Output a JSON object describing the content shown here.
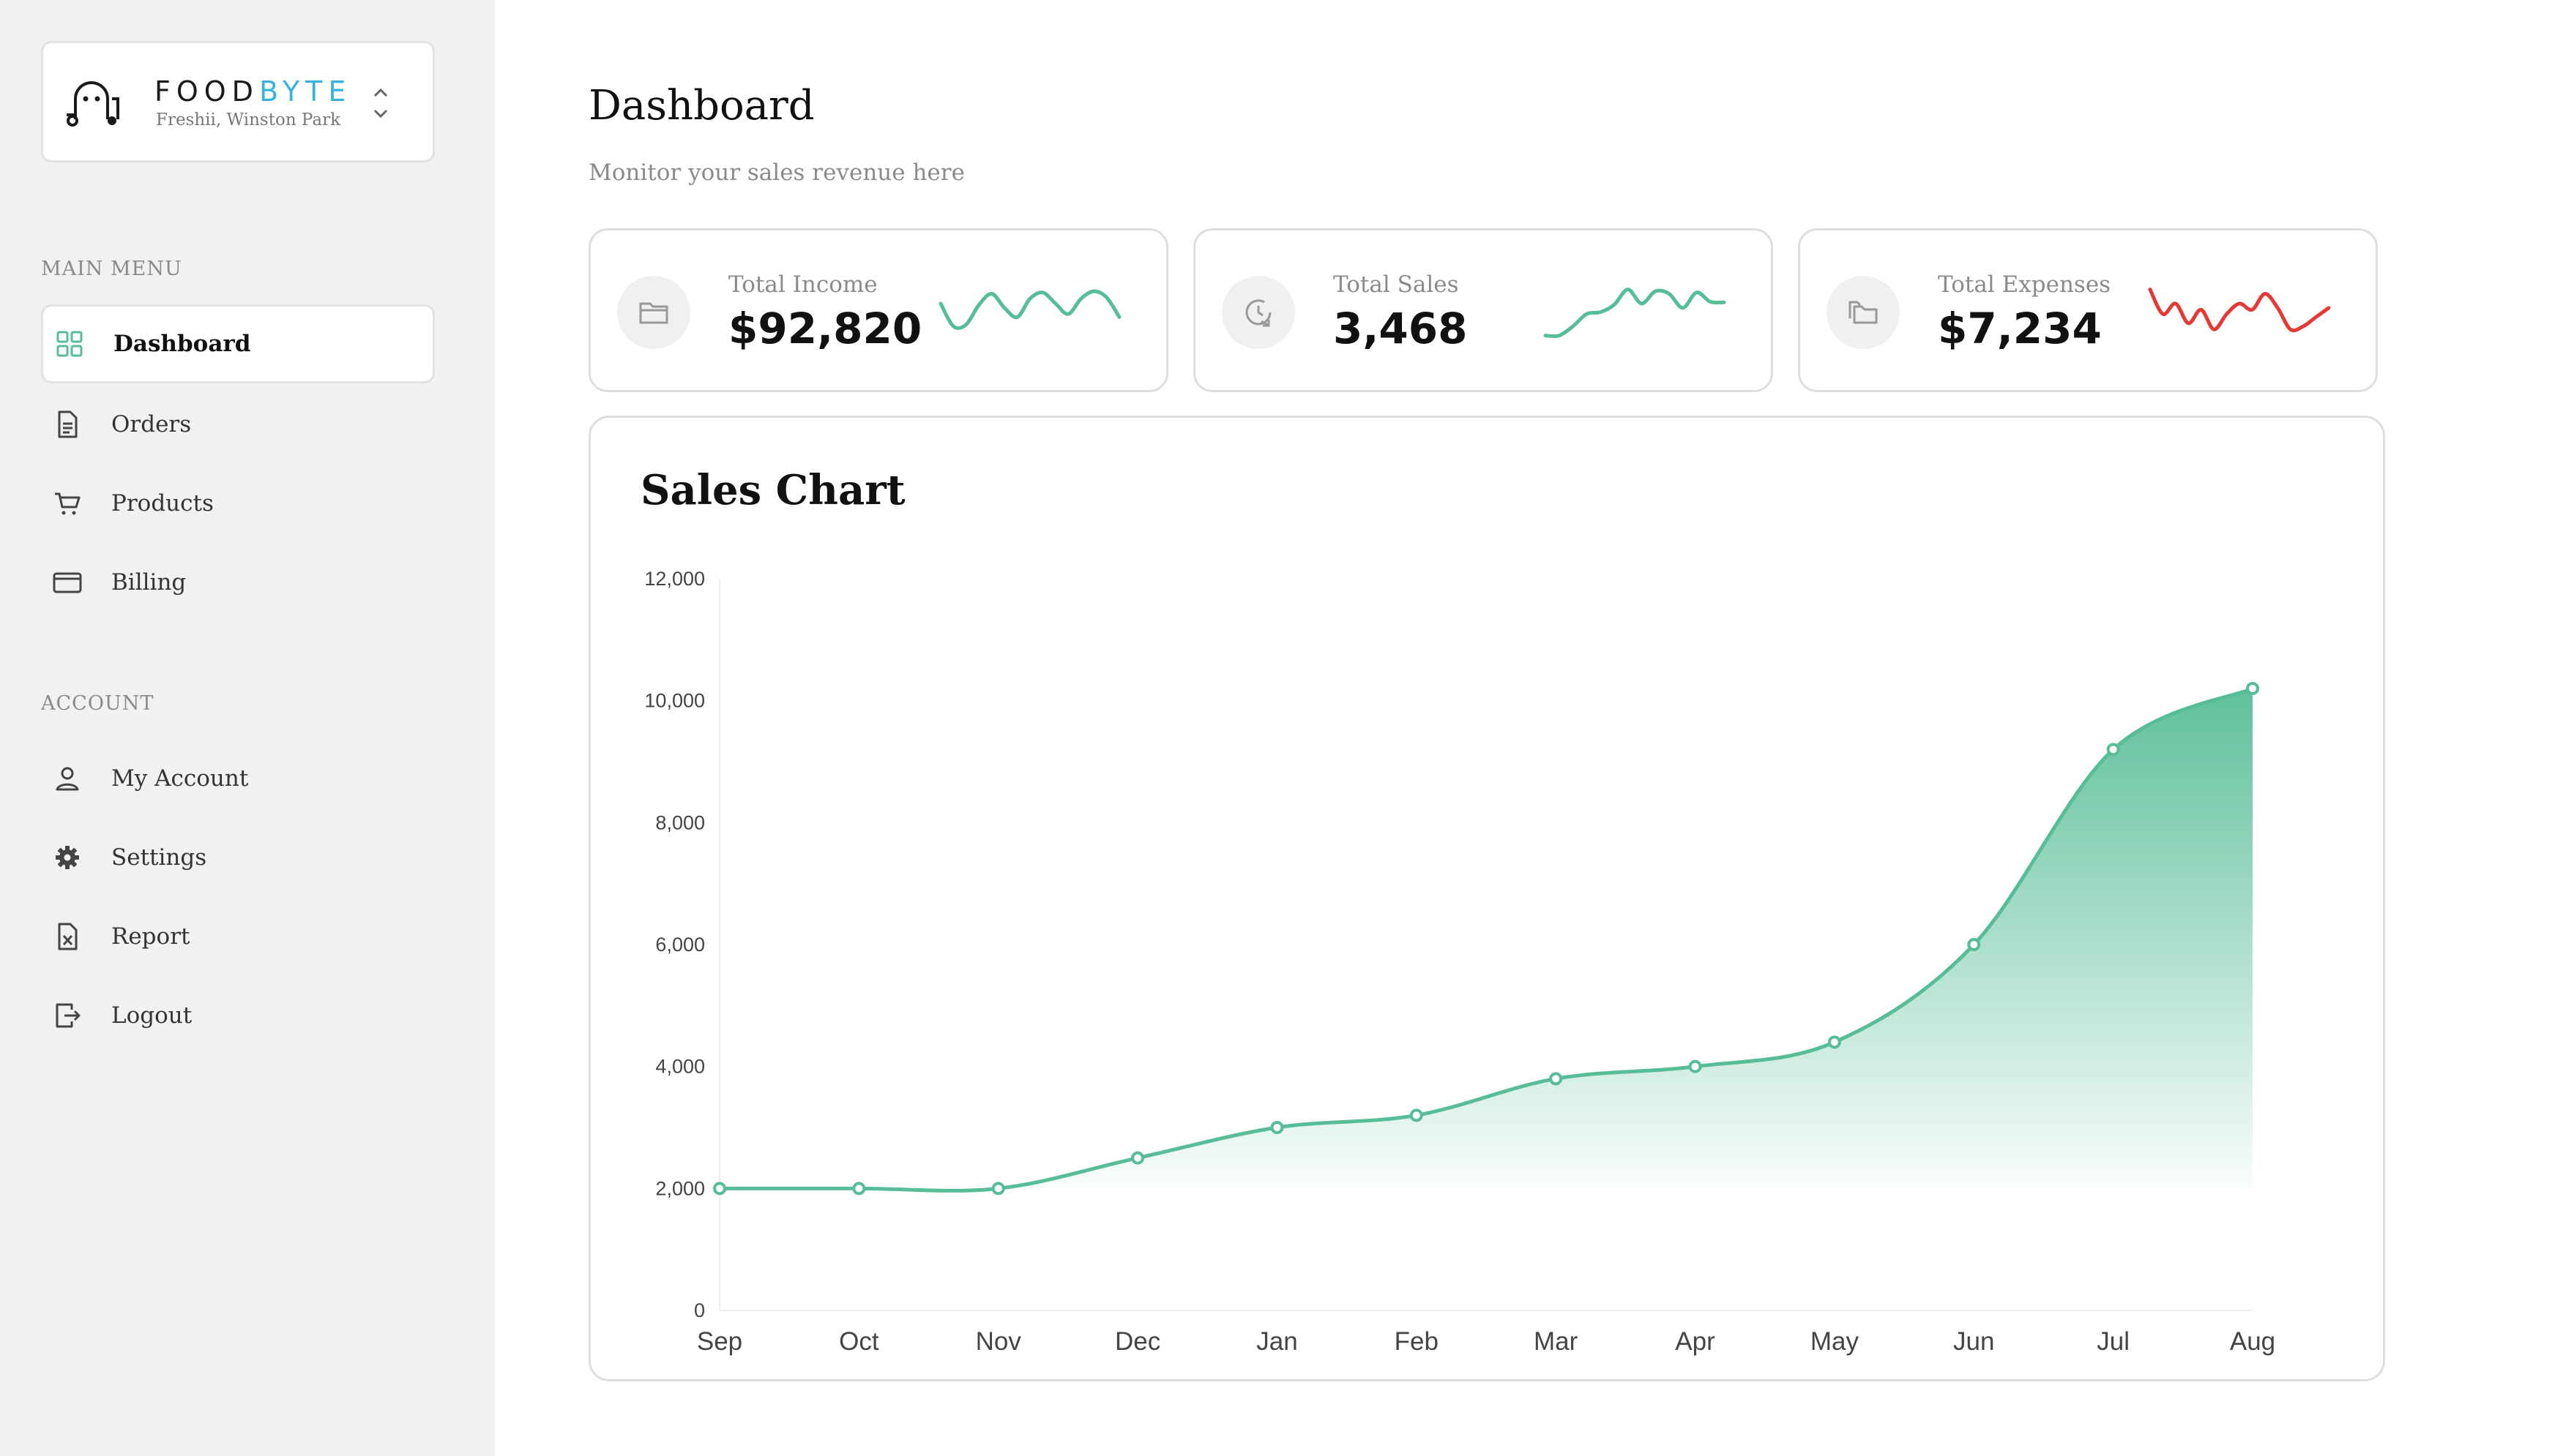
{
  "brand": {
    "name_part1": "FOOD",
    "name_part2": "BYTE",
    "location": "Freshii, Winston Park",
    "accent": "#35b3dc",
    "logo_icon": "ghost-truck-logo",
    "switcher_icon": "chevron-up-down-icon"
  },
  "sidebar": {
    "main_menu_label": "MAIN MENU",
    "main_items": [
      {
        "label": "Dashboard",
        "icon": "grid-icon",
        "active": true
      },
      {
        "label": "Orders",
        "icon": "document-icon"
      },
      {
        "label": "Products",
        "icon": "cart-icon"
      },
      {
        "label": "Billing",
        "icon": "credit-card-icon"
      }
    ],
    "account_label": "ACCOUNT",
    "account_items": [
      {
        "label": "My Account",
        "icon": "user-icon"
      },
      {
        "label": "Settings",
        "icon": "gear-icon"
      },
      {
        "label": "Report",
        "icon": "spreadsheet-icon"
      },
      {
        "label": "Logout",
        "icon": "logout-icon"
      }
    ]
  },
  "header": {
    "title": "Dashboard",
    "subtitle": "Monitor your sales revenue here"
  },
  "stats": [
    {
      "label": "Total Income",
      "value": "$92,820",
      "icon": "folder-icon",
      "color": "#57bd97",
      "spark": [
        62,
        25,
        28,
        60,
        78,
        55,
        40,
        70,
        80,
        62,
        45,
        70,
        82,
        72,
        40
      ]
    },
    {
      "label": "Total Sales",
      "value": "3,468",
      "icon": "clock-arrow-icon",
      "color": "#57bd97",
      "spark": [
        10,
        10,
        25,
        45,
        48,
        60,
        85,
        62,
        82,
        78,
        55,
        80,
        65,
        64
      ]
    },
    {
      "label": "Total Expenses",
      "value": "$7,234",
      "icon": "folders-icon",
      "color": "#e53935",
      "spark": [
        85,
        45,
        62,
        30,
        52,
        20,
        45,
        62,
        52,
        78,
        55,
        20,
        25,
        40,
        55
      ]
    }
  ],
  "colors": {
    "accent": "#57bd97",
    "expense": "#e53935",
    "sidebar_bg": "#f1f1f1"
  },
  "chart_data": {
    "type": "area",
    "title": "Sales Chart",
    "categories": [
      "Sep",
      "Oct",
      "Nov",
      "Dec",
      "Jan",
      "Feb",
      "Mar",
      "Apr",
      "May",
      "Jun",
      "Jul",
      "Aug"
    ],
    "series": [
      {
        "values": [
          2000,
          2000,
          2000,
          2500,
          3000,
          3200,
          3800,
          4000,
          4400,
          6000,
          9200,
          10200
        ]
      }
    ],
    "yticks": [
      "0",
      "2,000",
      "4,000",
      "6,000",
      "8,000",
      "10,000",
      "12,000"
    ],
    "ylim": [
      0,
      12000
    ],
    "grid": false,
    "legend": "none",
    "color": "#57bd97"
  }
}
